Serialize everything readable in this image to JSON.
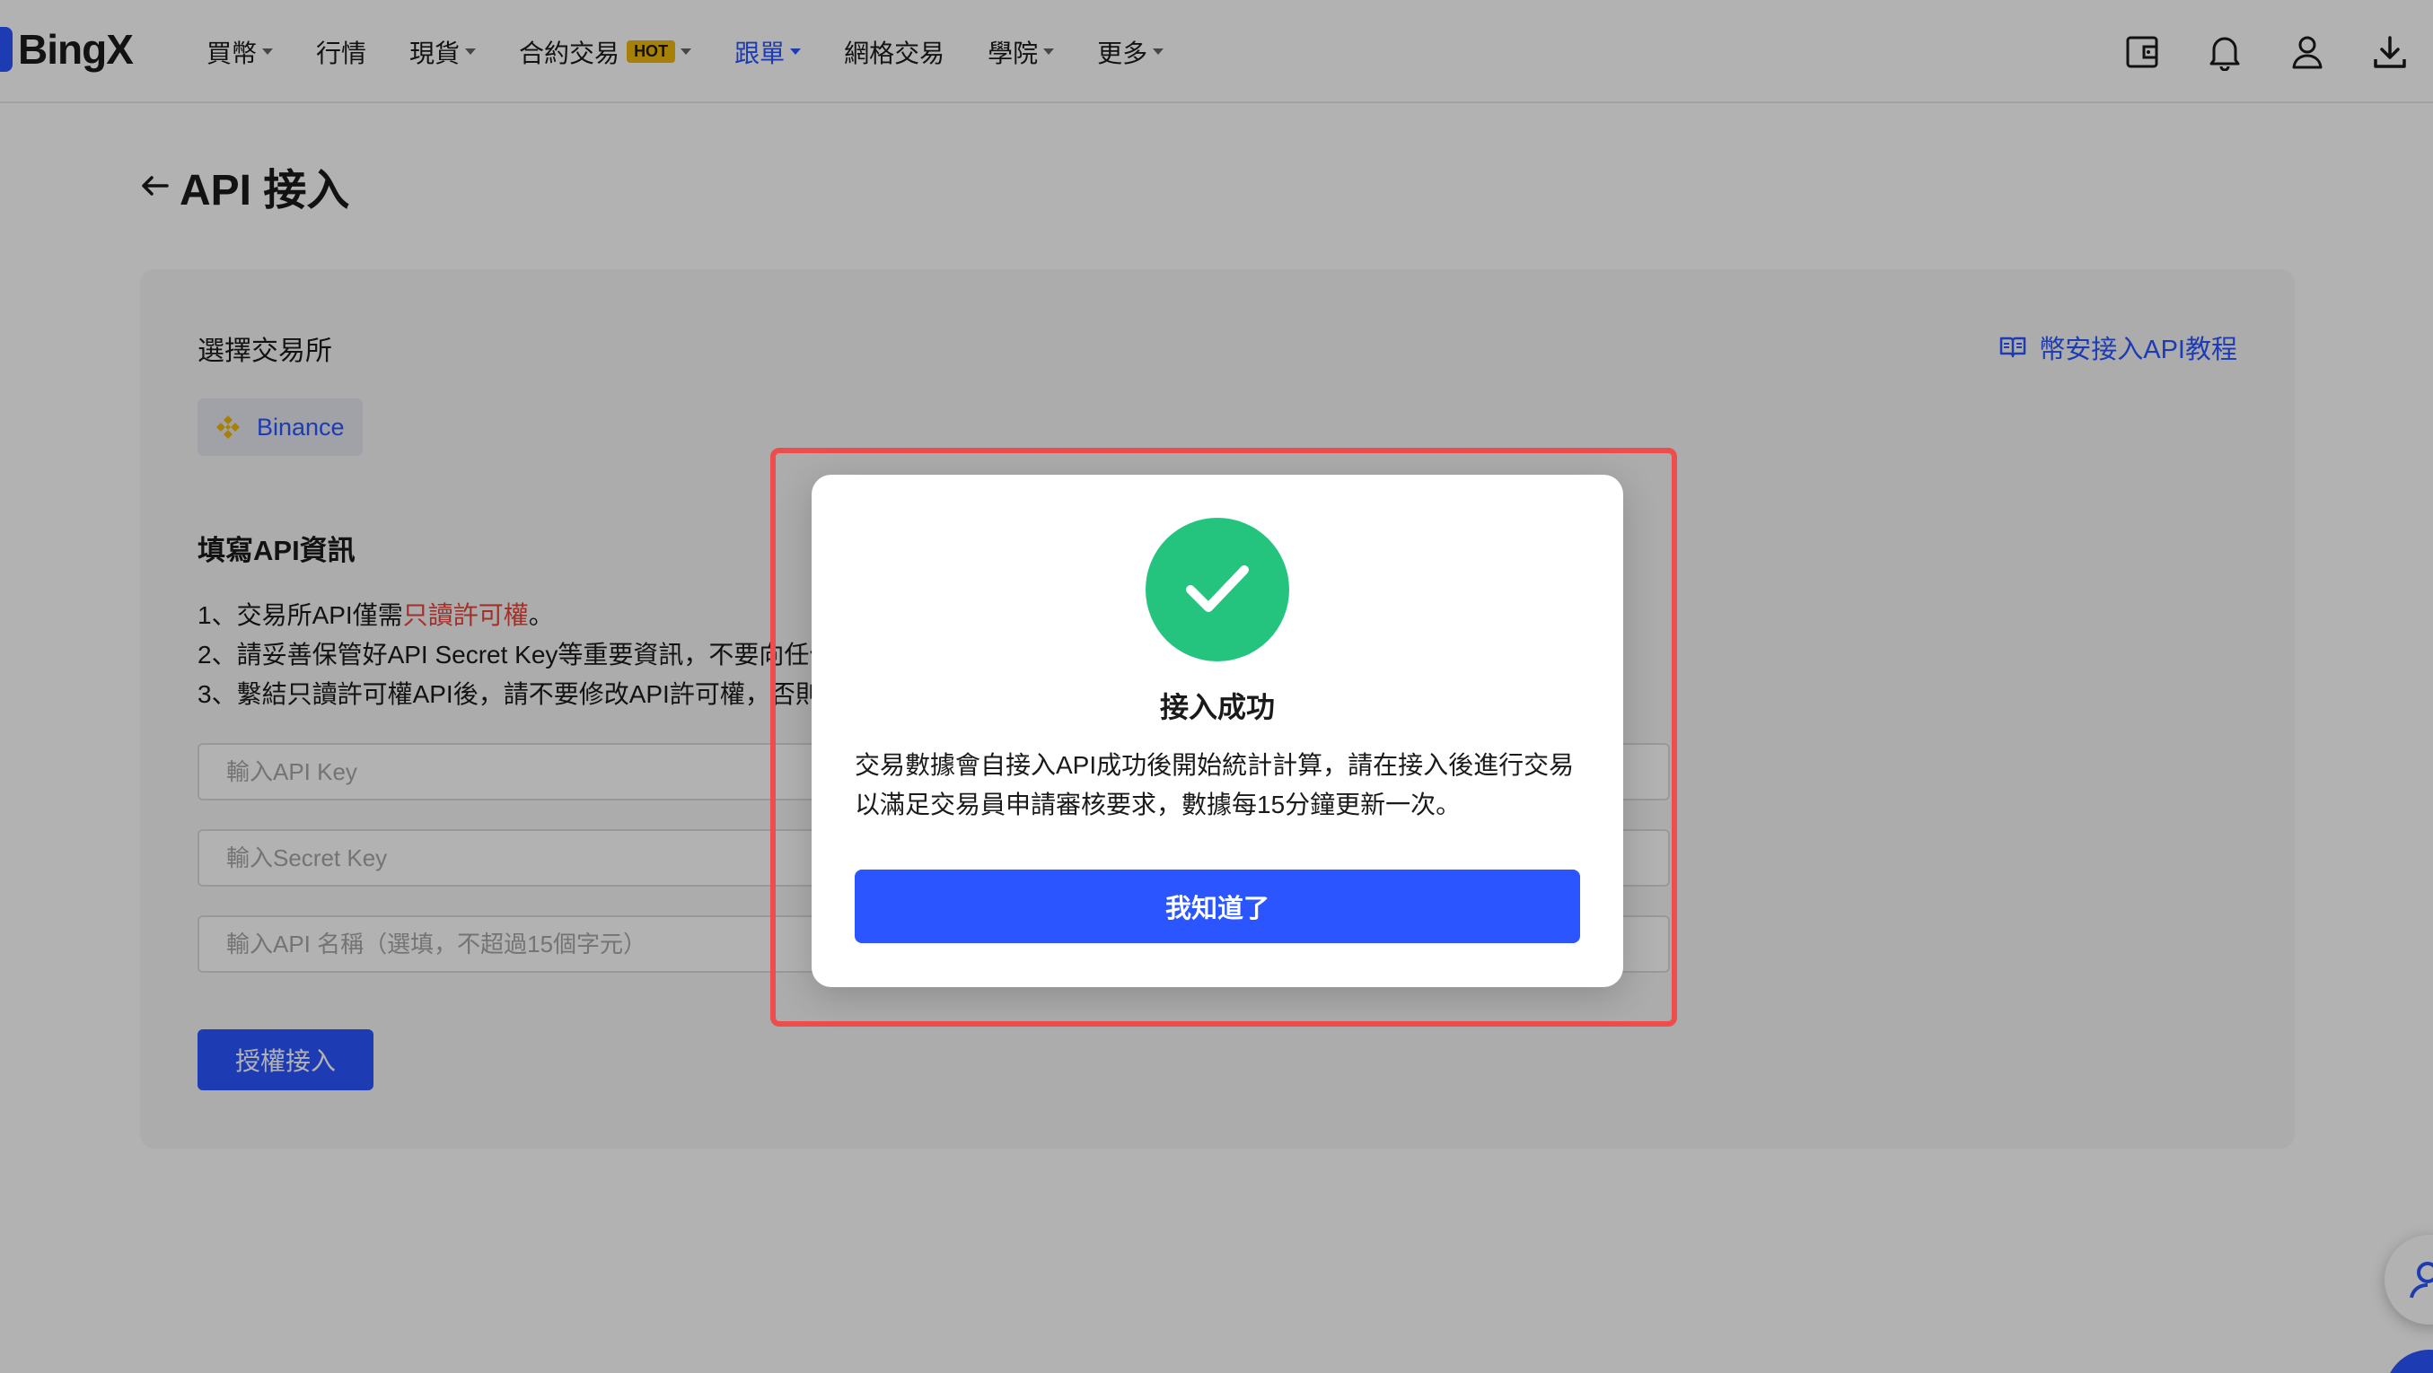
{
  "brand": {
    "name": "BingX",
    "accent": "#2a55ff"
  },
  "nav": {
    "items": [
      {
        "label": "買幣",
        "caret": true
      },
      {
        "label": "行情",
        "caret": false
      },
      {
        "label": "現貨",
        "caret": true
      },
      {
        "label": "合約交易",
        "caret": true,
        "badge": "HOT"
      },
      {
        "label": "跟單",
        "caret": true,
        "active": true
      },
      {
        "label": "網格交易",
        "caret": false
      },
      {
        "label": "學院",
        "caret": true
      },
      {
        "label": "更多",
        "caret": true
      }
    ]
  },
  "header_icons": [
    "wallet-icon",
    "bell-icon",
    "user-icon",
    "download-icon"
  ],
  "page": {
    "title": "API 接入"
  },
  "form": {
    "exchange_label": "選擇交易所",
    "tutorial_link": "幣安接入API教程",
    "exchange_chip": "Binance",
    "section_title": "填寫API資訊",
    "rule1_prefix": "1、交易所API僅需",
    "rule1_highlight": "只讀許可權",
    "rule1_suffix": "。",
    "rule2": "2、請妥善保管好API Secret Key等重要資訊，不要向任何",
    "rule3": "3、繫結只讀許可權API後，請不要修改API許可權，否則",
    "api_key_placeholder": "輸入API Key",
    "secret_key_placeholder": "輸入Secret Key",
    "api_name_placeholder": "輸入API 名稱（選填，不超過15個字元）",
    "submit_label": "授權接入"
  },
  "modal": {
    "title": "接入成功",
    "body": "交易數據會自接入API成功後開始統計計算，請在接入後進行交易以滿足交易員申請審核要求，數據每15分鐘更新一次。",
    "confirm_label": "我知道了",
    "success_color": "#24c47e",
    "highlight_color": "#ee4d4d"
  }
}
